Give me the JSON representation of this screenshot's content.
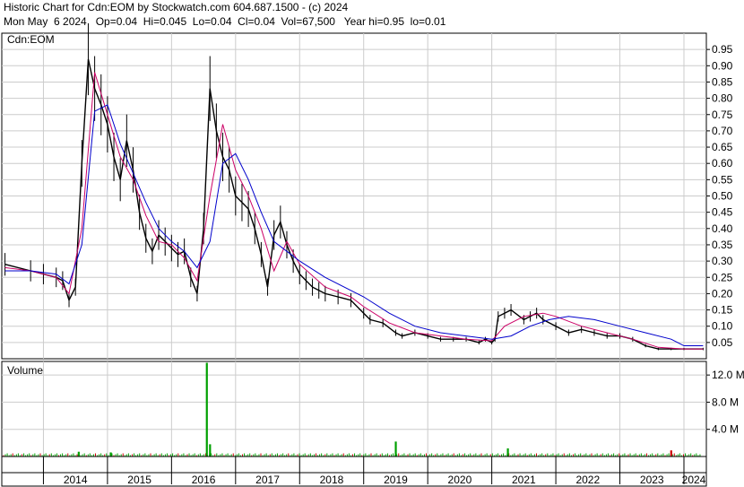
{
  "header": {
    "title_line": "Historic Chart for Cdn:EOM by Stockwatch.com 604.687.1500 - (c) 2024",
    "quote_line": "Mon May  6 2024   Op=0.04  Hi=0.045  Lo=0.04  Cl=0.04  Vol=67,500   Year hi=0.95  lo=0.01"
  },
  "chart_data": {
    "type": "line",
    "price_panel_label": "Cdn:EOM",
    "volume_panel_label": "Volume",
    "x_tick_labels": [
      "2014",
      "2015",
      "2016",
      "2017",
      "2018",
      "2019",
      "2020",
      "2021",
      "2022",
      "2023",
      "2024"
    ],
    "price_axis": {
      "ticks": [
        0.05,
        0.1,
        0.15,
        0.2,
        0.25,
        0.3,
        0.35,
        0.4,
        0.45,
        0.5,
        0.55,
        0.6,
        0.65,
        0.7,
        0.75,
        0.8,
        0.85,
        0.9,
        0.95
      ],
      "ylim": [
        0.0,
        1.0
      ]
    },
    "volume_axis": {
      "ticks": [
        "4.0 M",
        "8.0 M",
        "12.0 M"
      ],
      "values": [
        4,
        8,
        12
      ],
      "unit": "M",
      "ylim": [
        0,
        14
      ]
    },
    "colors": {
      "price_bars": "#000000",
      "ma_short": "#cc0066",
      "ma_long": "#0000cc",
      "volume": "#00a000",
      "volume_down": "#cc0000",
      "grid": "#cccccc"
    },
    "series": [
      {
        "key": "close",
        "x": [
          2013.4,
          2013.8,
          2014.0,
          2014.2,
          2014.3,
          2014.4,
          2014.5,
          2014.6,
          2014.7,
          2014.8,
          2014.9,
          2015.0,
          2015.1,
          2015.2,
          2015.3,
          2015.4,
          2015.5,
          2015.6,
          2015.7,
          2015.8,
          2015.9,
          2016.0,
          2016.1,
          2016.2,
          2016.3,
          2016.4,
          2016.5,
          2016.6,
          2016.7,
          2016.8,
          2016.9,
          2017.0,
          2017.1,
          2017.2,
          2017.3,
          2017.4,
          2017.5,
          2017.6,
          2017.7,
          2017.8,
          2017.9,
          2018.0,
          2018.1,
          2018.2,
          2018.3,
          2018.4,
          2018.6,
          2018.8,
          2019.0,
          2019.1,
          2019.3,
          2019.5,
          2019.6,
          2019.8,
          2020.0,
          2020.2,
          2020.4,
          2020.6,
          2020.8,
          2020.9,
          2021.0,
          2021.05,
          2021.1,
          2021.2,
          2021.3,
          2021.5,
          2021.6,
          2021.7,
          2021.8,
          2022.0,
          2022.2,
          2022.4,
          2022.6,
          2022.8,
          2023.0,
          2023.2,
          2023.4,
          2023.6,
          2023.8,
          2024.0,
          2024.3
        ],
        "values": [
          0.29,
          0.27,
          0.26,
          0.25,
          0.24,
          0.18,
          0.22,
          0.6,
          0.92,
          0.83,
          0.78,
          0.72,
          0.62,
          0.55,
          0.67,
          0.58,
          0.45,
          0.37,
          0.33,
          0.38,
          0.36,
          0.34,
          0.32,
          0.33,
          0.25,
          0.2,
          0.4,
          0.83,
          0.7,
          0.62,
          0.58,
          0.5,
          0.48,
          0.46,
          0.4,
          0.32,
          0.22,
          0.38,
          0.42,
          0.35,
          0.3,
          0.26,
          0.24,
          0.22,
          0.21,
          0.2,
          0.19,
          0.18,
          0.14,
          0.12,
          0.11,
          0.08,
          0.07,
          0.08,
          0.07,
          0.06,
          0.06,
          0.06,
          0.05,
          0.06,
          0.05,
          0.06,
          0.13,
          0.14,
          0.15,
          0.12,
          0.13,
          0.14,
          0.12,
          0.1,
          0.08,
          0.09,
          0.08,
          0.07,
          0.07,
          0.06,
          0.04,
          0.03,
          0.03,
          0.03,
          0.03
        ]
      },
      {
        "key": "ma_short",
        "x": [
          2013.4,
          2013.8,
          2014.2,
          2014.4,
          2014.6,
          2014.8,
          2015.0,
          2015.2,
          2015.4,
          2015.6,
          2015.8,
          2016.0,
          2016.2,
          2016.4,
          2016.6,
          2016.8,
          2017.0,
          2017.2,
          2017.4,
          2017.6,
          2017.8,
          2018.0,
          2018.4,
          2018.8,
          2019.0,
          2019.4,
          2019.8,
          2020.2,
          2020.6,
          2021.0,
          2021.2,
          2021.5,
          2021.8,
          2022.0,
          2022.4,
          2022.8,
          2023.2,
          2023.6,
          2024.0,
          2024.3
        ],
        "values": [
          0.28,
          0.27,
          0.25,
          0.2,
          0.4,
          0.88,
          0.75,
          0.62,
          0.55,
          0.44,
          0.36,
          0.35,
          0.31,
          0.24,
          0.5,
          0.72,
          0.58,
          0.5,
          0.4,
          0.27,
          0.36,
          0.29,
          0.22,
          0.19,
          0.16,
          0.11,
          0.08,
          0.07,
          0.06,
          0.055,
          0.1,
          0.13,
          0.14,
          0.13,
          0.1,
          0.08,
          0.06,
          0.035,
          0.03,
          0.03
        ]
      },
      {
        "key": "ma_long",
        "x": [
          2013.4,
          2013.8,
          2014.2,
          2014.4,
          2014.6,
          2014.8,
          2015.0,
          2015.2,
          2015.4,
          2015.6,
          2015.8,
          2016.0,
          2016.2,
          2016.4,
          2016.6,
          2016.8,
          2017.0,
          2017.2,
          2017.4,
          2017.6,
          2017.8,
          2018.0,
          2018.4,
          2018.8,
          2019.0,
          2019.4,
          2019.8,
          2020.2,
          2020.6,
          2021.0,
          2021.3,
          2021.6,
          2021.9,
          2022.2,
          2022.6,
          2023.0,
          2023.4,
          2023.8,
          2024.0,
          2024.3
        ],
        "values": [
          0.27,
          0.27,
          0.26,
          0.23,
          0.35,
          0.76,
          0.78,
          0.66,
          0.57,
          0.48,
          0.4,
          0.36,
          0.33,
          0.28,
          0.36,
          0.6,
          0.63,
          0.55,
          0.45,
          0.36,
          0.33,
          0.3,
          0.25,
          0.21,
          0.19,
          0.14,
          0.1,
          0.08,
          0.07,
          0.06,
          0.07,
          0.1,
          0.12,
          0.13,
          0.12,
          0.1,
          0.08,
          0.06,
          0.04,
          0.04
        ]
      }
    ],
    "volume_spikes": [
      {
        "x": 2016.55,
        "value": 13.8
      },
      {
        "x": 2016.6,
        "value": 1.8
      },
      {
        "x": 2019.5,
        "value": 2.2
      },
      {
        "x": 2021.25,
        "value": 1.2
      },
      {
        "x": 2014.55,
        "value": 0.7
      },
      {
        "x": 2015.05,
        "value": 0.6
      },
      {
        "x": 2023.8,
        "value": 0.9
      }
    ]
  }
}
